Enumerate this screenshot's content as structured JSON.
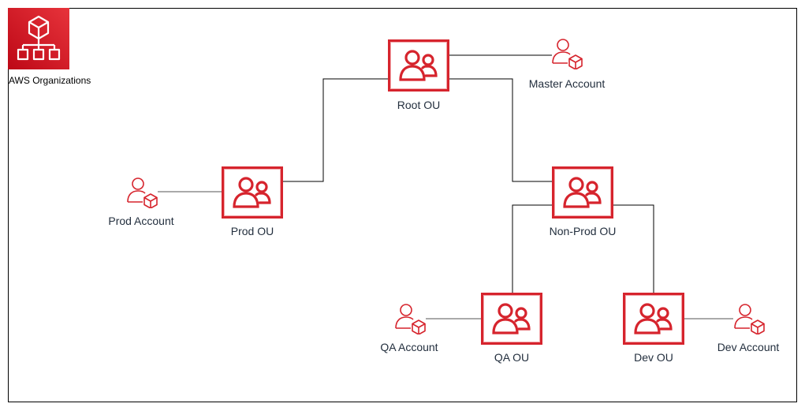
{
  "diagram": {
    "service": {
      "label": "AWS Organizations",
      "icon": "aws-organizations-icon",
      "color": "#d6242d"
    },
    "nodes": {
      "root_ou": {
        "label": "Root OU",
        "type": "organizational-unit"
      },
      "master_account": {
        "label": "Master Account",
        "type": "account"
      },
      "prod_ou": {
        "label": "Prod OU",
        "type": "organizational-unit"
      },
      "prod_account": {
        "label": "Prod Account",
        "type": "account"
      },
      "nonprod_ou": {
        "label": "Non-Prod OU",
        "type": "organizational-unit"
      },
      "qa_ou": {
        "label": "QA OU",
        "type": "organizational-unit"
      },
      "qa_account": {
        "label": "QA Account",
        "type": "account"
      },
      "dev_ou": {
        "label": "Dev OU",
        "type": "organizational-unit"
      },
      "dev_account": {
        "label": "Dev Account",
        "type": "account"
      }
    },
    "edges": [
      {
        "from": "Root OU",
        "to": "Master Account"
      },
      {
        "from": "Root OU",
        "to": "Prod OU"
      },
      {
        "from": "Root OU",
        "to": "Non-Prod OU"
      },
      {
        "from": "Prod OU",
        "to": "Prod Account"
      },
      {
        "from": "Non-Prod OU",
        "to": "QA OU"
      },
      {
        "from": "Non-Prod OU",
        "to": "Dev OU"
      },
      {
        "from": "QA OU",
        "to": "QA Account"
      },
      {
        "from": "Dev OU",
        "to": "Dev Account"
      }
    ]
  }
}
